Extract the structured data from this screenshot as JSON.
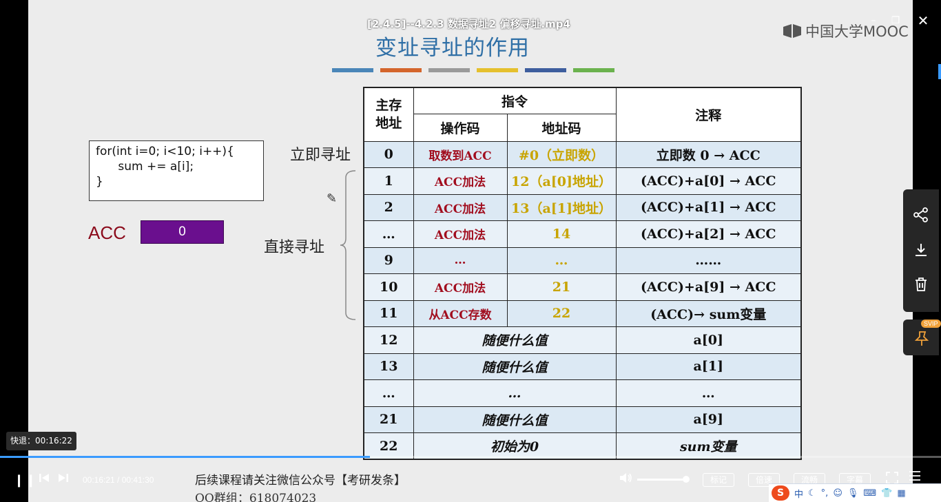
{
  "window": {
    "title": "[2.4.5]--4.2.3 数据寻址2 偏移寻址.mp4",
    "minimize_icon": "minimize-icon",
    "restore_icon": "restore-icon",
    "close_icon": "close-icon"
  },
  "slide": {
    "logo_text": "中国大学MOOC",
    "title": "变址寻址的作用",
    "accent_bars": [
      "#4a86b8",
      "#d4652c",
      "#9a9a9a",
      "#e5c02e",
      "#3e5e9e",
      "#6bb24e"
    ],
    "code_lines": [
      "for(int i=0; i<10; i++){",
      "      sum += a[i];",
      "}"
    ],
    "acc_label": "ACC",
    "acc_value": "0",
    "label_immediate": "立即寻址",
    "label_direct": "直接寻址",
    "table": {
      "header": {
        "main_memory": "主存地址",
        "instruction": "指令",
        "opcode": "操作码",
        "address_code": "地址码",
        "comment": "注释"
      },
      "instr_rows": [
        {
          "addr": "0",
          "op": "取数到ACC",
          "code": "#0（立即数）",
          "note": "立即数 0 → ACC"
        },
        {
          "addr": "1",
          "op": "ACC加法",
          "code": "12（a[0]地址）",
          "note": "(ACC)+a[0] → ACC"
        },
        {
          "addr": "2",
          "op": "ACC加法",
          "code": "13（a[1]地址）",
          "note": "(ACC)+a[1] → ACC"
        },
        {
          "addr": "…",
          "op": "ACC加法",
          "code": "14",
          "note": "(ACC)+a[2] → ACC"
        },
        {
          "addr": "9",
          "op": "…",
          "code": "…",
          "note": "……"
        },
        {
          "addr": "10",
          "op": "ACC加法",
          "code": "21",
          "note": "(ACC)+a[9] → ACC"
        },
        {
          "addr": "11",
          "op": "从ACC存数",
          "code": "22",
          "note": "(ACC)→ sum变量"
        }
      ],
      "data_rows": [
        {
          "addr": "12",
          "value": "随便什么值",
          "note": "a[0]"
        },
        {
          "addr": "13",
          "value": "随便什么值",
          "note": "a[1]"
        },
        {
          "addr": "…",
          "value": "…",
          "note": "…"
        },
        {
          "addr": "21",
          "value": "随便什么值",
          "note": "a[9]"
        },
        {
          "addr": "22",
          "value": "初始为0",
          "note": "sum变量"
        }
      ]
    }
  },
  "player": {
    "seek_tooltip": "快退：00:16:22",
    "progress": 0.393,
    "time_display": "00:16:21 / 00:41:30",
    "notice_line1": "后续课程请关注微信公众号【考研发条】",
    "notice_line2": "QQ群组：618074023",
    "volume": 0.95,
    "buttons": {
      "marker": "标记",
      "speed": "倍速",
      "quality": "流畅",
      "subtitle": "字幕"
    },
    "side_icons": [
      "share-icon",
      "download-icon",
      "delete-icon"
    ],
    "svip_badge": "SVIP",
    "pin_icon": "pin-icon"
  },
  "ime": {
    "logo": "S",
    "mode": "中"
  }
}
